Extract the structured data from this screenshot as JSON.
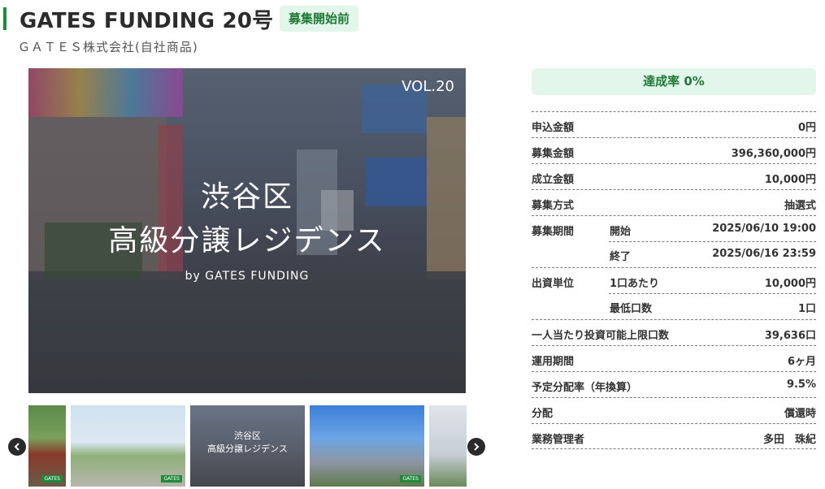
{
  "header": {
    "title": "GATES FUNDING 20号",
    "status": "募集開始前",
    "company": "ＧＡＴＥＳ株式会社(自社商品)"
  },
  "hero": {
    "vol": "VOL.20",
    "title_line1": "渋谷区",
    "title_line2": "高級分譲レジデンス",
    "byline": "by GATES FUNDING"
  },
  "thumbnails": {
    "third_line1": "渋谷区",
    "third_line2": "高級分譲レジデンス",
    "tag_text": "GATES"
  },
  "rate": {
    "label": "達成率 0%"
  },
  "info": {
    "applied_label": "申込金額",
    "applied_value": "0円",
    "target_label": "募集金額",
    "target_value": "396,360,000円",
    "min_label": "成立金額",
    "min_value": "10,000円",
    "method_label": "募集方式",
    "method_value": "抽選式",
    "period_label": "募集期間",
    "period_start_label": "開始",
    "period_start_value": "2025/06/10 19:00",
    "period_end_label": "終了",
    "period_end_value": "2025/06/16 23:59",
    "unit_label": "出資単位",
    "unit_per_label": "1口あたり",
    "unit_per_value": "10,000円",
    "unit_min_label": "最低口数",
    "unit_min_value": "1口",
    "limit_label": "一人当たり投資可能上限口数",
    "limit_value": "39,636口",
    "term_label": "運用期間",
    "term_value": "6ヶ月",
    "yield_label": "予定分配率（年換算）",
    "yield_value": "9.5%",
    "dist_label": "分配",
    "dist_value": "償還時",
    "manager_label": "業務管理者",
    "manager_value": "多田　珠紀"
  },
  "colors": {
    "accent": "#1f8a3a",
    "badge_bg": "#e3f6ec",
    "badge_text": "#1f7a35"
  },
  "icons": {
    "prev": "chevron-left-icon",
    "next": "chevron-right-icon"
  }
}
